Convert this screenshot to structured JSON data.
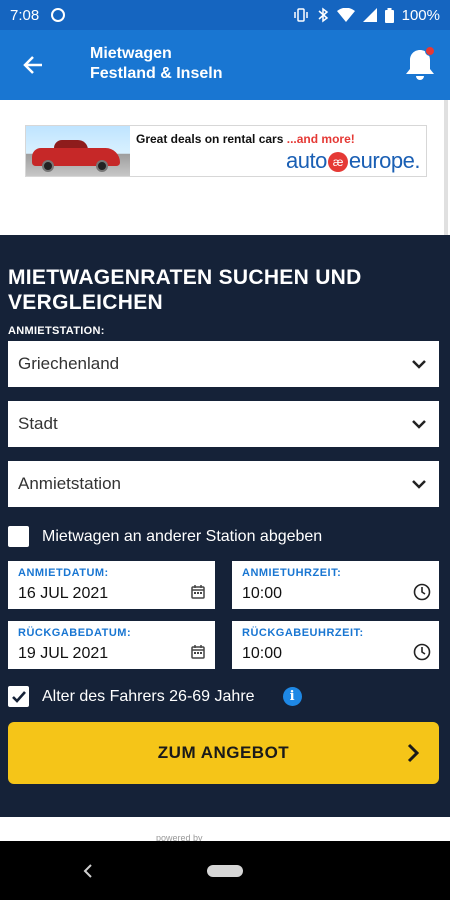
{
  "status_bar": {
    "time": "7:08",
    "battery": "100%",
    "icons": [
      "sync-icon",
      "vibrate-icon",
      "bluetooth-icon",
      "wifi-icon",
      "signal-icon",
      "battery-icon"
    ]
  },
  "app_bar": {
    "title_line1": "Mietwagen",
    "title_line2": "Festland & Inseln",
    "icons": [
      "back-arrow-icon",
      "bell-icon"
    ],
    "colors": {
      "status": "#1565c0",
      "bar": "#1976d2",
      "badge": "#e53935"
    }
  },
  "ad": {
    "line_black": "Great deals on rental cars",
    "line_red": " ...and more!",
    "brand_left": "auto",
    "brand_mark": "æ",
    "brand_right": "europe",
    "brand_dot": "."
  },
  "form": {
    "heading": "MIETWAGENRATEN SUCHEN UND VERGLEICHEN",
    "pickup_label": "ANMIETSTATION:",
    "country": "Griechenland",
    "city": "Stadt",
    "station": "Anmietstation",
    "other_station_label": "Mietwagen an anderer Station abgeben",
    "other_station_checked": false,
    "pickup_date_label": "ANMIETDATUM:",
    "pickup_date": "16 JUL 2021",
    "pickup_time_label": "ANMIETUHRZEIT:",
    "pickup_time": "10:00",
    "return_date_label": "RÜCKGABEDATUM:",
    "return_date": "19 JUL 2021",
    "return_time_label": "RÜCKGABEUHRZEIT:",
    "return_time": "10:00",
    "driver_age_label": "Alter des Fahrers 26-69 Jahre",
    "driver_age_checked": true,
    "info_glyph": "i",
    "cta_label": "ZUM ANGEBOT",
    "colors": {
      "panel": "#152238",
      "cta": "#f5c518",
      "field_label": "#1976d2"
    }
  },
  "footer": {
    "powered_by": "powered by"
  }
}
